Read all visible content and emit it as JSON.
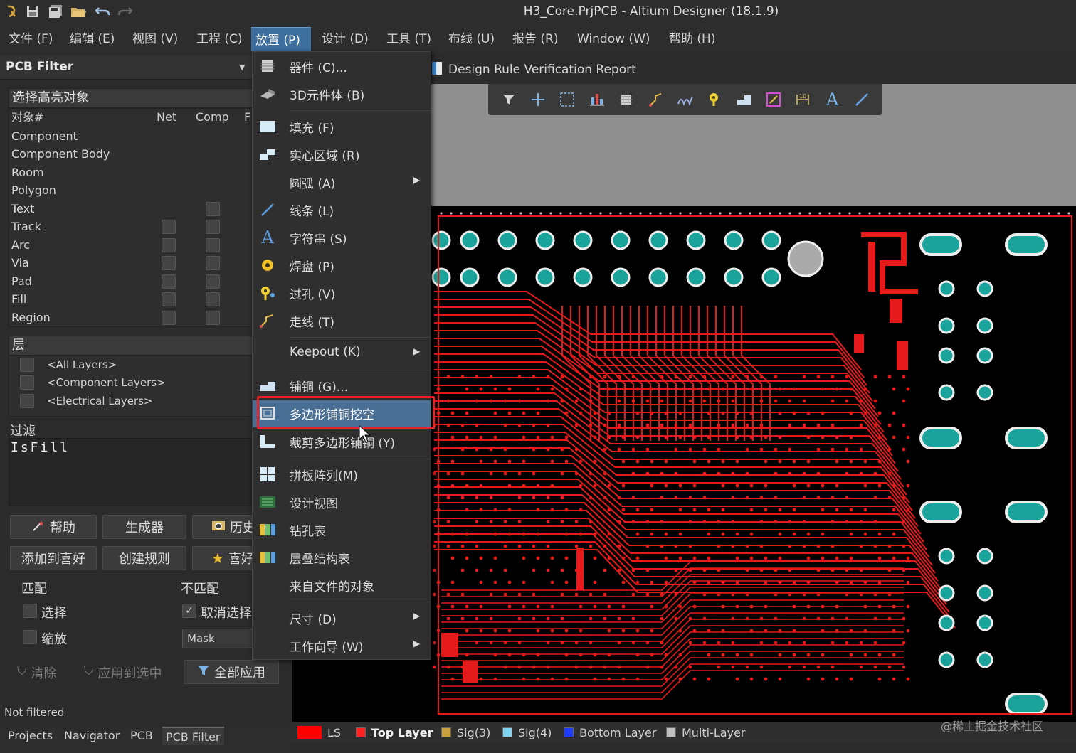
{
  "window": {
    "title": "H3_Core.PrjPCB - Altium Designer (18.1.9)"
  },
  "menubar": [
    {
      "label": "文件 (F)"
    },
    {
      "label": "编辑 (E)"
    },
    {
      "label": "视图 (V)"
    },
    {
      "label": "工程 (C)"
    },
    {
      "label": "放置 (P)"
    },
    {
      "label": "设计 (D)"
    },
    {
      "label": "工具 (T)"
    },
    {
      "label": "布线 (U)"
    },
    {
      "label": "报告 (R)"
    },
    {
      "label": "Window (W)"
    },
    {
      "label": "帮助 (H)"
    }
  ],
  "panel": {
    "title": "PCB Filter",
    "objects_title": "选择高亮对象",
    "col_object": "对象#",
    "col_net": "Net",
    "col_comp": "Comp",
    "col_f": "F",
    "rows": [
      "Component",
      "Component Body",
      "Room",
      "Polygon",
      "Text",
      "Track",
      "Arc",
      "Via",
      "Pad",
      "Fill",
      "Region"
    ],
    "layers_title": "层",
    "layers": [
      "<All Layers>",
      "<Component Layers>",
      "<Electrical Layers>"
    ],
    "filter_title": "过滤",
    "filter_text": "IsFill",
    "btn_help": "帮助",
    "btn_builder": "生成器",
    "btn_history": "历史",
    "btn_add_fav": "添加到喜好",
    "btn_create_rule": "创建规则",
    "btn_fav": "喜好",
    "match_label": "匹配",
    "nomatch_label": "不匹配",
    "select_label": "选择",
    "deselect_label": "取消选择",
    "zoom_label": "缩放",
    "mask_value": "Mask",
    "btn_clear": "清除",
    "btn_apply_sel": "应用到选中",
    "btn_apply_all": "全部应用",
    "status": "Not filtered"
  },
  "bottom_tabs": [
    "Projects",
    "Navigator",
    "PCB",
    "PCB Filter"
  ],
  "doc_tab": "Design Rule Verification Report",
  "dropdown": {
    "items": [
      {
        "label": "器件 (C)...",
        "icon": "component-icon"
      },
      {
        "label": "3D元件体 (B)",
        "icon": "3d-body-icon"
      },
      {
        "label": "填充 (F)",
        "icon": "fill-icon"
      },
      {
        "label": "实心区域 (R)",
        "icon": "solid-region-icon"
      },
      {
        "label": "圆弧 (A)",
        "icon": "none"
      },
      {
        "label": "线条 (L)",
        "icon": "line-icon"
      },
      {
        "label": "字符串 (S)",
        "icon": "string-icon"
      },
      {
        "label": "焊盘 (P)",
        "icon": "pad-icon"
      },
      {
        "label": "过孔 (V)",
        "icon": "via-icon"
      },
      {
        "label": "走线 (T)",
        "icon": "track-icon"
      },
      {
        "label": "Keepout (K)",
        "icon": "none"
      },
      {
        "label": "铺铜 (G)...",
        "icon": "polygon-pour-icon"
      },
      {
        "label": "多边形铺铜挖空",
        "icon": "polygon-cutout-icon"
      },
      {
        "label": "裁剪多边形铺铜 (Y)",
        "icon": "slice-polygon-icon"
      },
      {
        "label": "拼板阵列(M)",
        "icon": "panel-array-icon"
      },
      {
        "label": "设计视图",
        "icon": "design-view-icon"
      },
      {
        "label": "钻孔表",
        "icon": "drill-table-icon"
      },
      {
        "label": "层叠结构表",
        "icon": "layer-stack-table-icon"
      },
      {
        "label": "来自文件的对象",
        "icon": "none"
      },
      {
        "label": "尺寸 (D)",
        "icon": "none"
      },
      {
        "label": "工作向导 (W)",
        "icon": "none"
      }
    ]
  },
  "layer_tabs": [
    {
      "label": "LS",
      "color": "#ff0000"
    },
    {
      "label": "Top Layer",
      "color": "#ff2020"
    },
    {
      "label": "Sig(3)",
      "color": "#c8a040"
    },
    {
      "label": "Sig(4)",
      "color": "#7fd3f0"
    },
    {
      "label": "Bottom Layer",
      "color": "#1e3cff"
    },
    {
      "label": "Multi-Layer",
      "color": "#c0c0c0"
    }
  ],
  "watermark": "@稀土掘金技术社区",
  "colors": {
    "accent": "#3c6e9e",
    "highlight_box": "#e8222a",
    "trace": "#e51b1b",
    "pad": "#1aa39a"
  }
}
